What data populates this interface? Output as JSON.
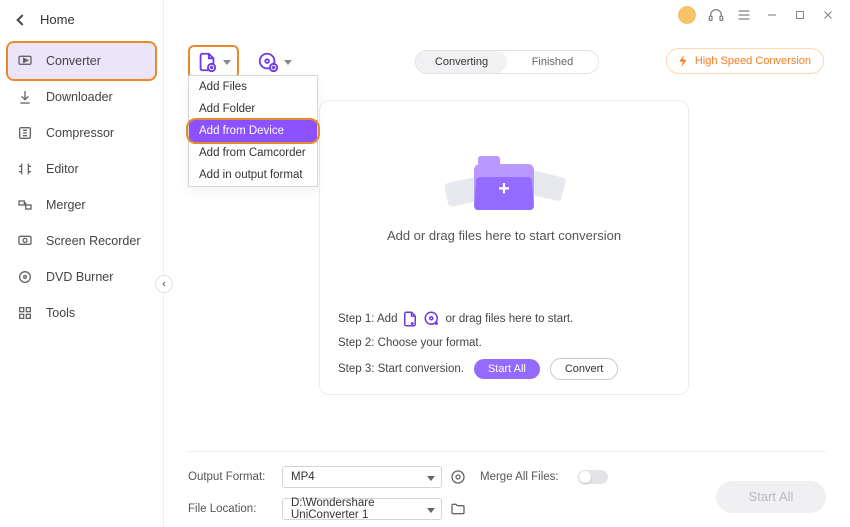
{
  "titlebar": {
    "icons": [
      "user-badge",
      "headset",
      "menu",
      "minimize",
      "maximize",
      "close"
    ]
  },
  "sidebar": {
    "home_label": "Home",
    "items": [
      {
        "label": "Converter",
        "icon": "converter"
      },
      {
        "label": "Downloader",
        "icon": "downloader"
      },
      {
        "label": "Compressor",
        "icon": "compressor"
      },
      {
        "label": "Editor",
        "icon": "editor"
      },
      {
        "label": "Merger",
        "icon": "merger"
      },
      {
        "label": "Screen Recorder",
        "icon": "screen-recorder"
      },
      {
        "label": "DVD Burner",
        "icon": "dvd-burner"
      },
      {
        "label": "Tools",
        "icon": "tools"
      }
    ],
    "active_index": 0
  },
  "topbar": {
    "segmented": {
      "options": [
        "Converting",
        "Finished"
      ],
      "active": 0
    },
    "high_speed_label": "High Speed Conversion"
  },
  "dropdown": {
    "items": [
      "Add Files",
      "Add Folder",
      "Add from Device",
      "Add from Camcorder",
      "Add in output format"
    ],
    "highlighted_index": 2
  },
  "dropzone": {
    "main_text": "Add or drag files here to start conversion",
    "step1_prefix": "Step 1: Add",
    "step1_suffix": "or drag files here to start.",
    "step2": "Step 2: Choose your format.",
    "step3": "Step 3: Start conversion.",
    "start_all_btn": "Start All",
    "convert_btn": "Convert"
  },
  "footer": {
    "output_format_label": "Output Format:",
    "output_format_value": "MP4",
    "file_location_label": "File Location:",
    "file_location_value": "D:\\Wondershare UniConverter 1",
    "merge_label": "Merge All Files:",
    "merge_on": false,
    "start_all_label": "Start All"
  }
}
